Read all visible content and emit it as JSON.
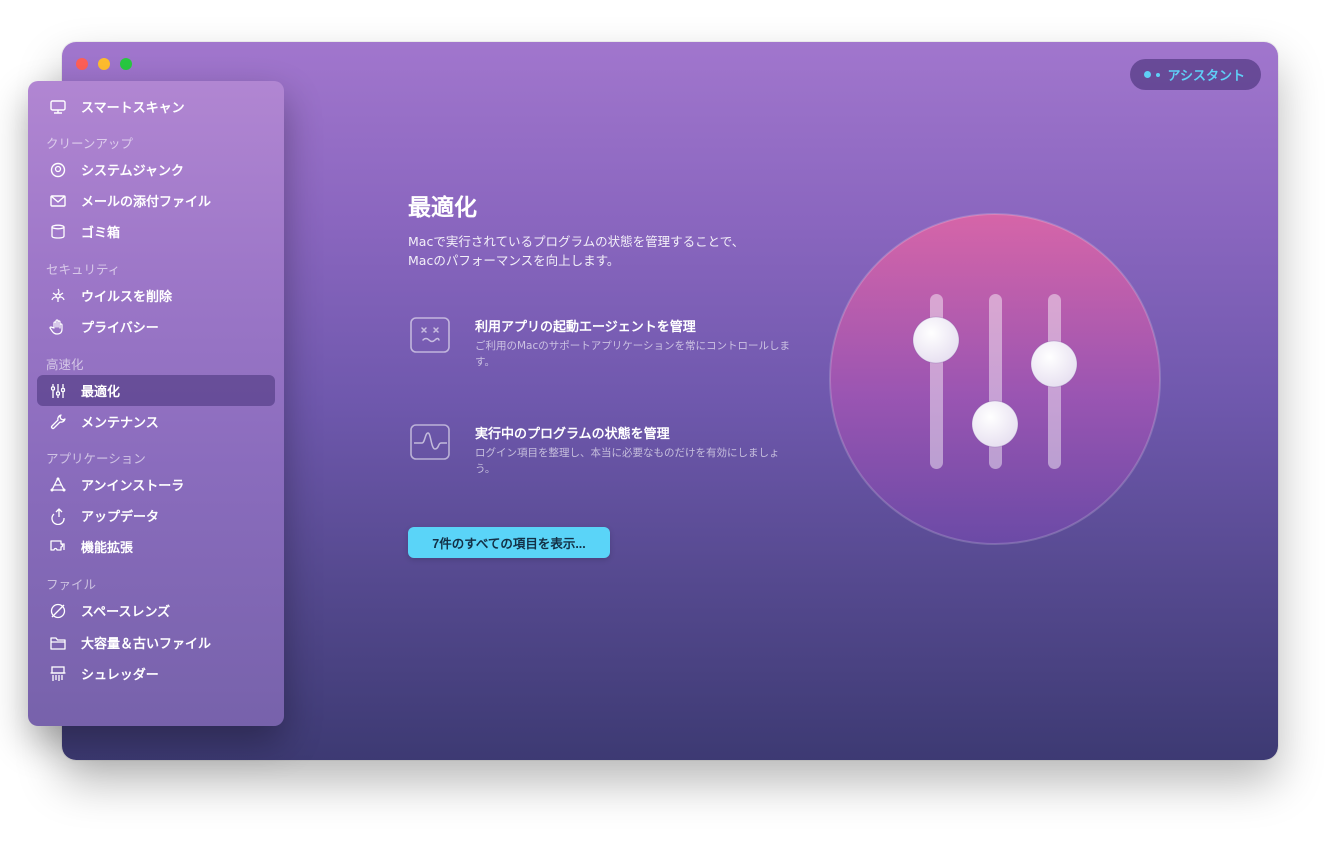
{
  "window": {
    "controls": [
      "close",
      "minimize",
      "zoom"
    ]
  },
  "assistant": {
    "label": "アシスタント"
  },
  "sidebar": {
    "items": [
      {
        "label": "スマートスキャン",
        "icon": "monitor-icon"
      },
      {
        "section": "クリーンアップ"
      },
      {
        "label": "システムジャンク",
        "icon": "system-junk-icon"
      },
      {
        "label": "メールの添付ファイル",
        "icon": "envelope-icon"
      },
      {
        "label": "ゴミ箱",
        "icon": "trash-icon"
      },
      {
        "section": "セキュリティ"
      },
      {
        "label": "ウイルスを削除",
        "icon": "biohazard-icon"
      },
      {
        "label": "プライバシー",
        "icon": "hand-icon"
      },
      {
        "section": "高速化"
      },
      {
        "label": "最適化",
        "icon": "sliders-icon",
        "active": true
      },
      {
        "label": "メンテナンス",
        "icon": "wrench-icon"
      },
      {
        "section": "アプリケーション"
      },
      {
        "label": "アンインストーラ",
        "icon": "uninstaller-icon"
      },
      {
        "label": "アップデータ",
        "icon": "updater-icon"
      },
      {
        "label": "機能拡張",
        "icon": "extensions-icon"
      },
      {
        "section": "ファイル"
      },
      {
        "label": "スペースレンズ",
        "icon": "space-lens-icon"
      },
      {
        "label": "大容量＆古いファイル",
        "icon": "folder-icon"
      },
      {
        "label": "シュレッダー",
        "icon": "shredder-icon"
      }
    ]
  },
  "main": {
    "title": "最適化",
    "description": "Macで実行されているプログラムの状態を管理することで、Macのパフォーマンスを向上します。",
    "features": [
      {
        "title": "利用アプリの起動エージェントを管理",
        "description": "ご利用のMacのサポートアプリケーションを常にコントロールします。",
        "icon": "agent-face-icon"
      },
      {
        "title": "実行中のプログラムの状態を管理",
        "description": "ログイン項目を整理し、本当に必要なものだけを有効にしましょう。",
        "icon": "activity-monitor-icon"
      }
    ],
    "cta_label": "7件のすべての項目を表示...",
    "hero_icon": "sliders-hero-icon"
  },
  "colors": {
    "accent": "#5ad4f8",
    "assistant_text": "#5fd0f7",
    "window_top": "#a176cd",
    "window_bottom": "#3d3a73",
    "hero_top": "#d665a8",
    "hero_bottom": "#6b4aa6"
  }
}
